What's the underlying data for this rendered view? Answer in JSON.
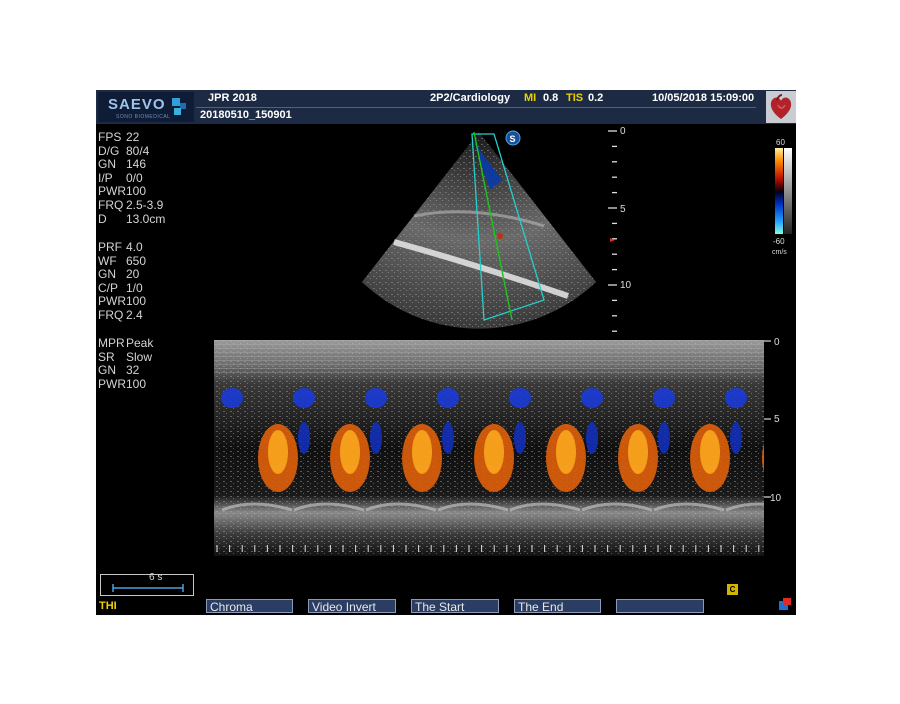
{
  "header": {
    "brand": "SAEVO",
    "brand_sub": "SONO BIOMEDICAL",
    "title": "JPR 2018",
    "file_id": "20180510_150901",
    "probe_preset": "2P2/Cardiology",
    "mi_label": "MI",
    "mi_value": "0.8",
    "tis_label": "TIS",
    "tis_value": "0.2",
    "datetime": "10/05/2018 15:09:00"
  },
  "params_2d": [
    {
      "key": "FPS",
      "value": "22"
    },
    {
      "key": "D/G",
      "value": "80/4"
    },
    {
      "key": "GN",
      "value": "146"
    },
    {
      "key": "I/P",
      "value": "0/0"
    },
    {
      "key": "PWR",
      "value": "100"
    },
    {
      "key": "FRQ",
      "value": "2.5-3.9"
    },
    {
      "key": "D",
      "value": "13.0cm"
    }
  ],
  "params_color": [
    {
      "key": "PRF",
      "value": "4.0"
    },
    {
      "key": "WF",
      "value": "650"
    },
    {
      "key": "GN",
      "value": "20"
    },
    {
      "key": "C/P",
      "value": "1/0"
    },
    {
      "key": "PWR",
      "value": "100"
    },
    {
      "key": "FRQ",
      "value": "2.4"
    }
  ],
  "params_mmode": [
    {
      "key": "MPR",
      "value": "Peak"
    },
    {
      "key": "SR",
      "value": "Slow"
    },
    {
      "key": "GN",
      "value": "32"
    },
    {
      "key": "PWR",
      "value": "100"
    }
  ],
  "depth_scale": [
    "0",
    "5",
    "10"
  ],
  "mmode_scale": [
    "0",
    "5",
    "10"
  ],
  "color_scale": {
    "max": "60",
    "min": "-60",
    "unit": "cm/s"
  },
  "sweep": {
    "label": "6 s"
  },
  "mode_label": "THI",
  "softkeys": [
    "Chroma",
    "Video Invert",
    "The Start",
    "The End",
    ""
  ],
  "icons": {
    "orientation": "steer-s-icon",
    "cine": "cine-c-icon",
    "heart": "heart-icon",
    "corner": "window-icon"
  },
  "colors": {
    "header_bg": "#1c2a44",
    "accent_yellow": "#f0d000",
    "roi_cyan": "#22d0d0",
    "cursor_green": "#19c819"
  }
}
